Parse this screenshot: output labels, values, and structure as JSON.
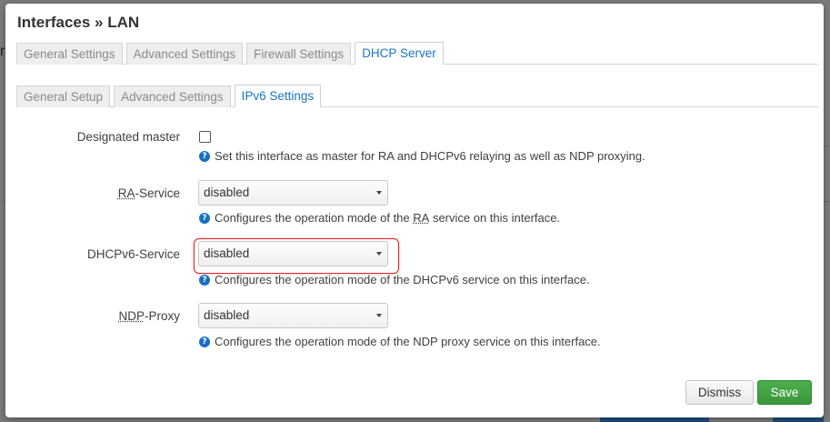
{
  "modal": {
    "title": "Interfaces » LAN"
  },
  "background": {
    "partial_text": "r"
  },
  "main_tabs": [
    {
      "label": "General Settings",
      "active": false
    },
    {
      "label": "Advanced Settings",
      "active": false
    },
    {
      "label": "Firewall Settings",
      "active": false
    },
    {
      "label": "DHCP Server",
      "active": true
    }
  ],
  "sub_tabs": [
    {
      "label": "General Setup",
      "active": false
    },
    {
      "label": "Advanced Settings",
      "active": false
    },
    {
      "label": "IPv6 Settings",
      "active": true
    }
  ],
  "fields": {
    "designated_master": {
      "label": "Designated master",
      "checked": false,
      "help": "Set this interface as master for RA and DHCPv6 relaying as well as NDP proxying."
    },
    "ra_service": {
      "label_abbr": "RA",
      "label_rest": "-Service",
      "value": "disabled",
      "help_pre": "Configures the operation mode of the ",
      "help_abbr": "RA",
      "help_post": " service on this interface."
    },
    "dhcpv6_service": {
      "label": "DHCPv6-Service",
      "value": "disabled",
      "help": "Configures the operation mode of the DHCPv6 service on this interface.",
      "highlighted": true
    },
    "ndp_proxy": {
      "label_abbr": "NDP",
      "label_rest": "-Proxy",
      "value": "disabled",
      "help": "Configures the operation mode of the NDP proxy service on this interface."
    }
  },
  "help_icon_glyph": "?",
  "buttons": {
    "dismiss": "Dismiss",
    "save": "Save"
  },
  "colors": {
    "accent": "#1a74c4",
    "save": "#44a544",
    "highlight": "#e02424"
  }
}
